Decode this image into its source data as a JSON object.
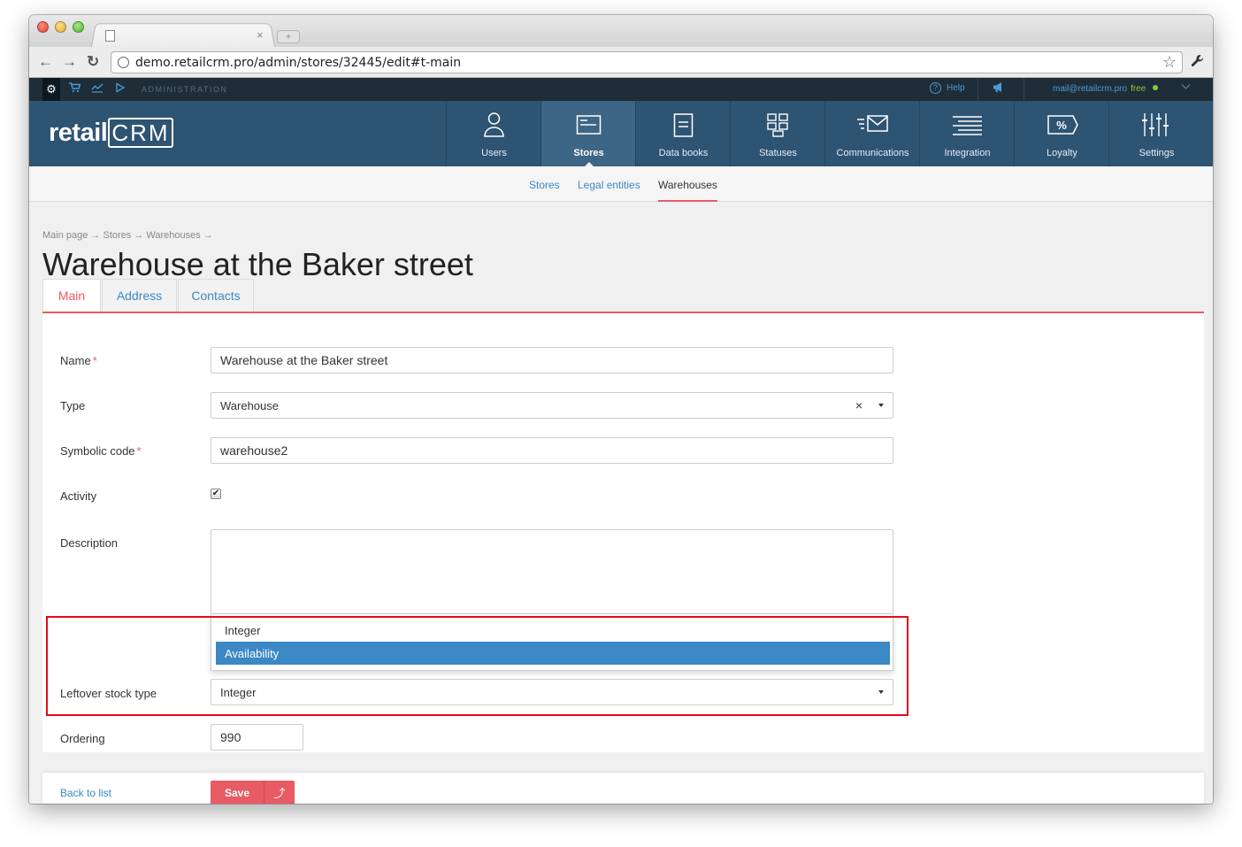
{
  "browser": {
    "tab_close": "×",
    "new_tab": "+",
    "url": "demo.retailcrm.pro/admin/stores/32445/edit#t-main",
    "back": "←",
    "forward": "→",
    "reload": "↻",
    "star": "☆",
    "wrench": "🔧"
  },
  "adminbar": {
    "label": "ADMINISTRATION",
    "help": "Help",
    "help_mark": "?",
    "email": "mail@retailcrm.pro",
    "plan": "free"
  },
  "logo": {
    "retail": "retail",
    "crm": "CRM"
  },
  "nav": {
    "items": [
      {
        "label": "Users",
        "icon": "user-icon"
      },
      {
        "label": "Stores",
        "icon": "store-icon"
      },
      {
        "label": "Data books",
        "icon": "book-icon"
      },
      {
        "label": "Statuses",
        "icon": "statuses-icon"
      },
      {
        "label": "Communications",
        "icon": "communications-icon"
      },
      {
        "label": "Integration",
        "icon": "integration-icon"
      },
      {
        "label": "Loyalty",
        "icon": "loyalty-icon"
      },
      {
        "label": "Settings",
        "icon": "settings-icon"
      }
    ],
    "active": "Stores"
  },
  "subnav": {
    "items": [
      "Stores",
      "Legal entities",
      "Warehouses"
    ],
    "current": "Warehouses"
  },
  "breadcrumb": "Main page → Stores → Warehouses →",
  "page_title": "Warehouse at the Baker street",
  "form_tabs": [
    "Main",
    "Address",
    "Contacts"
  ],
  "form": {
    "name_label": "Name",
    "name_value": "Warehouse at the Baker street",
    "type_label": "Type",
    "type_value": "Warehouse",
    "code_label": "Symbolic code",
    "code_value": "warehouse2",
    "activity_label": "Activity",
    "activity_checked": true,
    "description_label": "Description",
    "stock_label": "Leftover stock type",
    "stock_value": "Integer",
    "stock_options": [
      "Integer",
      "Availability"
    ],
    "stock_highlighted": "Availability",
    "ordering_label": "Ordering",
    "ordering_value": "990",
    "required_mark": "*"
  },
  "footer": {
    "back": "Back to list",
    "save": "Save",
    "save_arrow": "⤴"
  },
  "colors": {
    "accent": "#e85a64",
    "link": "#3b88c4",
    "nav_bg": "#2e5473",
    "admin_bg": "#1f2d38",
    "highlight_box": "#e00b1c"
  }
}
